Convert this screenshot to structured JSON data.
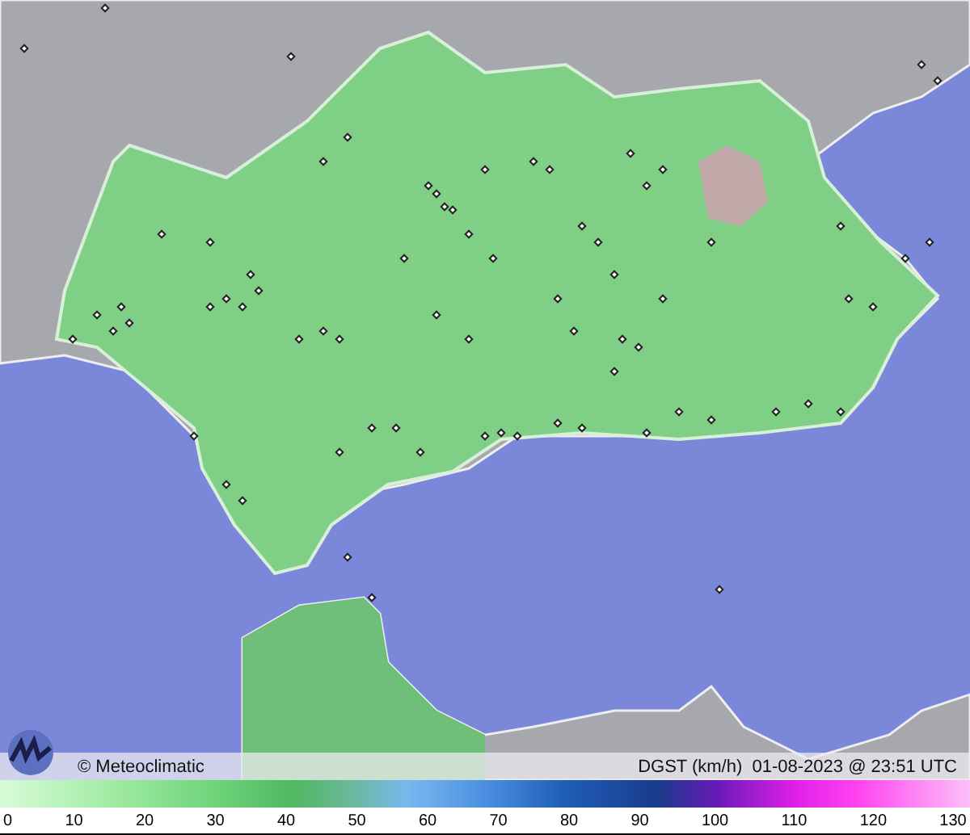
{
  "footer": {
    "copyright": "© Meteoclimatic",
    "caption": "DGST (km/h)  01-08-2023 @ 23:51 UTC"
  },
  "scale": {
    "ticks": [
      "0",
      "10",
      "20",
      "30",
      "40",
      "50",
      "60",
      "70",
      "80",
      "90",
      "100",
      "110",
      "120",
      "130"
    ]
  }
}
